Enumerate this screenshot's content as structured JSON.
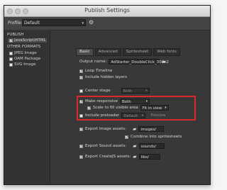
{
  "window": {
    "title": "Publish Settings"
  },
  "profile": {
    "label": "Profile:",
    "value": "Default"
  },
  "sidebar": {
    "publish_header": "PUBLISH",
    "javascript_html": "JavaScript/HTML",
    "other_formats_header": "OTHER FORMATS",
    "jpeg_image": "JPEG Image",
    "oam_package": "OAM Package",
    "svg_image": "SVG Image"
  },
  "tabs": [
    {
      "label": "Basic",
      "active": true
    },
    {
      "label": "Advanced",
      "active": false
    },
    {
      "label": "Spritesheet",
      "active": false
    },
    {
      "label": "Web fonts",
      "active": false
    }
  ],
  "basic": {
    "output_name_label": "Output name:",
    "output_name_value": "AdStarter_DoubleClick_300x2",
    "loop_timeline": "Loop Timeline",
    "include_hidden_layers": "Include hidden layers",
    "center_stage": "Center stage",
    "center_stage_value": "Both",
    "make_responsive": "Make responsive",
    "make_responsive_value": "Both",
    "scale_to_fill": "Scale to fill visible area",
    "scale_to_fill_value": "Fit in view",
    "include_preloader": "Include preloader",
    "include_preloader_value": "Default",
    "preview_label": "Preview",
    "export_image_assets": "Export image assets:",
    "image_assets_path": "images/",
    "combine_spritesheets": "Combine into spritesheets",
    "export_sound_assets": "Export Sound assets:",
    "sound_assets_path": "sounds/",
    "export_createjs_assets": "Export CreateJS assets:",
    "createjs_assets_path": "libs/"
  },
  "icons": {
    "gear": "gear-icon",
    "folder": "folder-icon",
    "chevron": "chevron-down-icon"
  },
  "colors": {
    "highlight": "#d62b2b",
    "panel": "#383838"
  }
}
